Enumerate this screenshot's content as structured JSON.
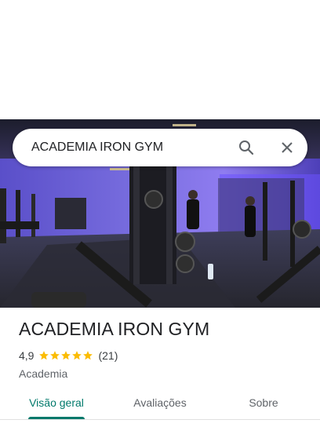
{
  "search": {
    "query": "ACADEMIA IRON GYM"
  },
  "place": {
    "name": "ACADEMIA IRON GYM",
    "rating": "4,9",
    "rating_fraction": 0.98,
    "review_count": "(21)",
    "category": "Academia"
  },
  "tabs": [
    {
      "label": "Visão geral",
      "active": true
    },
    {
      "label": "Avaliações",
      "active": false
    },
    {
      "label": "Sobre",
      "active": false
    }
  ],
  "colors": {
    "accent": "#00796b",
    "star": "#fbbc04",
    "hero_light": "#6f4dff"
  },
  "icons": [
    "search-icon",
    "close-icon",
    "star-icon"
  ]
}
